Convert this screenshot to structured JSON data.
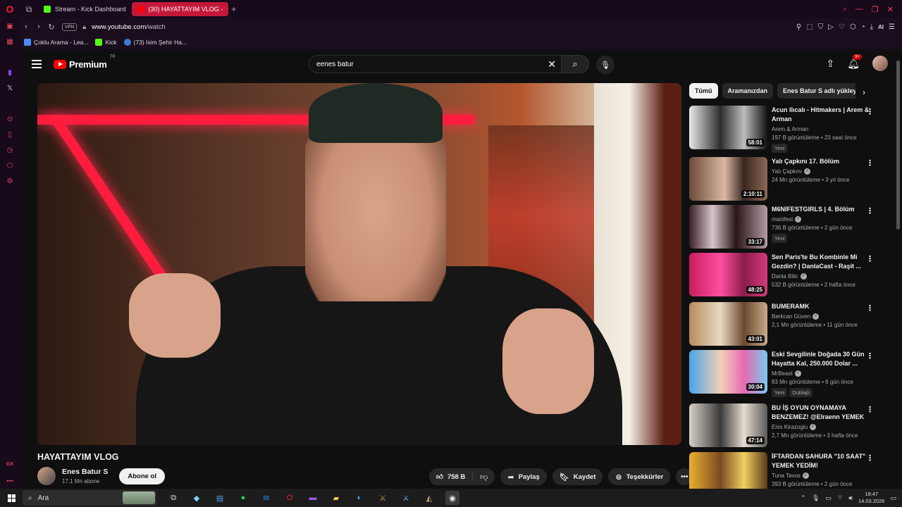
{
  "browser": {
    "tabs": [
      {
        "label": "Stream - Kick Dashboard",
        "color": "#53fc18",
        "active": false
      },
      {
        "label": "(30) HAYATTAYIM VLOG -",
        "color": "#ff0000",
        "active": true
      }
    ],
    "new_tab": "+",
    "vpn": "VPN",
    "url_domain": "www.youtube.com",
    "url_path": "/watch",
    "ai_label": "AI",
    "bookmarks": [
      {
        "label": "Çoklu Arama - Lea...",
        "color": "#4a8cff"
      },
      {
        "label": "Kick",
        "color": "#53fc18"
      },
      {
        "label": "(73) İsim Şehir Ha...",
        "color": "#3b7bd9"
      }
    ],
    "sidebar_gx": "GX"
  },
  "youtube": {
    "logo_text": "Premium",
    "region": "TR",
    "search_value": "eenes batur",
    "notif_badge": "9+",
    "video": {
      "title": "HAYATTAYIM VLOG",
      "channel": "Enes Batur S",
      "subscribers": "17,1 Mn abone",
      "subscribe_label": "Abone ol",
      "likes": "758 B",
      "share": "Paylaş",
      "save": "Kaydet",
      "thanks": "Teşekkürler"
    },
    "chips": [
      "Tümü",
      "Aramanızdan",
      "Enes Batur S adlı yükleyiciden"
    ],
    "recommendations": [
      {
        "title": "Acun Ilıcalı - Hitmakers | Arem & Arman",
        "channel": "Arem & Arman",
        "verified": false,
        "meta": "197 B görüntüleme • 23 saat önce",
        "tags": [
          "Yeni"
        ],
        "duration": "58:01",
        "thumb": "linear-gradient(90deg,#e8e8e8,#2d2d2d 40%,#bdbdbd 70%,#111)"
      },
      {
        "title": "Yalı Çapkını 17. Bölüm",
        "channel": "Yalı Çapkını",
        "verified": true,
        "meta": "24 Mn görüntüleme • 3 yıl önce",
        "tags": [],
        "duration": "2:10:11",
        "thumb": "linear-gradient(90deg,#6b4a3a,#d9b8a2 45%,#3a2620 70%,#8c6a55)"
      },
      {
        "title": "M6NIFESTGIRLS | 4. Bölüm",
        "channel": "manifest",
        "verified": true,
        "meta": "736 B görüntüleme • 2 gün önce",
        "tags": [
          "Yeni"
        ],
        "duration": "33:17",
        "thumb": "linear-gradient(90deg,#3a1d26,#d8c4c8 30%,#2a1418 60%,#b49da2)"
      },
      {
        "title": "Sen Paris'te Bu Kombinle Mi Gezdin? | DanlaCast - Raşit ...",
        "channel": "Danla Bilic",
        "verified": true,
        "meta": "532 B görüntüleme • 2 hafta önce",
        "tags": [],
        "duration": "48:25",
        "thumb": "linear-gradient(90deg,#c71e5e,#ff4fa0 40%,#8c1c4a 70%,#d43b7c)"
      },
      {
        "title": "BUMERAMK",
        "channel": "Berkcan Güven",
        "verified": true,
        "meta": "2,1 Mn görüntüleme • 11 gün önce",
        "tags": [],
        "duration": "43:01",
        "thumb": "linear-gradient(90deg,#b88a5e,#e8d8c0 40%,#6a4a30 70%,#c9a98a)"
      },
      {
        "title": "Eski Sevgilinle Doğada 30 Gün Hayatta Kal, 250.000 Dolar ...",
        "channel": "MrBeast",
        "verified": true,
        "meta": "83 Mn görüntüleme • 6 gün önce",
        "tags": [
          "Yeni",
          "Dublajlı"
        ],
        "duration": "30:04",
        "thumb": "linear-gradient(90deg,#4aa3e8,#f1d1b8 40%,#e86ab0 70%,#7ac8f0)"
      },
      {
        "title": "BU İŞ OYUN OYNAMAYA BENZEMEZ! @Elraenn YEMEK ...",
        "channel": "Enis Kirazoglu",
        "verified": true,
        "meta": "2,7 Mn görüntüleme • 3 hafta önce",
        "tags": [],
        "duration": "47:14",
        "thumb": "linear-gradient(90deg,#d8d0c8,#3a3a3a 40%,#e8dcd0 70%,#5a5a5a)"
      },
      {
        "title": "İFTARDAN SAHURA \"10 SAAT\" YEMEK YEDİM!",
        "channel": "Tuna Tavus",
        "verified": true,
        "meta": "393 B görüntüleme • 2 gün önce",
        "tags": [],
        "duration": "",
        "thumb": "linear-gradient(90deg,#e8b030,#7a4a20 40%,#f0d060 70%,#5a3a18)"
      }
    ]
  },
  "taskbar": {
    "search_placeholder": "Ara",
    "time": "18:47",
    "date": "14.03.2026"
  }
}
